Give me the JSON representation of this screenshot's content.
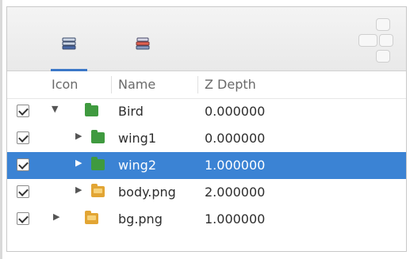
{
  "columns": {
    "icon": "Icon",
    "name": "Name",
    "z_depth": "Z Depth"
  },
  "layers": [
    {
      "name": "Bird",
      "z_depth": "0.000000",
      "checked": true,
      "expander": "expanded",
      "icon": "green-folder-icon",
      "level": 1,
      "selected": false
    },
    {
      "name": "wing1",
      "z_depth": "0.000000",
      "checked": true,
      "expander": "collapsed",
      "icon": "green-folder-icon",
      "level": 2,
      "selected": false
    },
    {
      "name": "wing2",
      "z_depth": "1.000000",
      "checked": true,
      "expander": "collapsed",
      "icon": "green-folder-icon",
      "level": 2,
      "selected": true
    },
    {
      "name": "body.png",
      "z_depth": "2.000000",
      "checked": true,
      "expander": "collapsed",
      "icon": "yellow-image-folder-icon",
      "level": 2,
      "selected": false
    },
    {
      "name": "bg.png",
      "z_depth": "1.000000",
      "checked": true,
      "expander": "collapsed",
      "icon": "yellow-image-folder-icon",
      "level": 1,
      "selected": false
    }
  ],
  "colors": {
    "selection": "#3b83d4",
    "tab_underline": "#3c78c8",
    "folder_green": "#3f9a3f",
    "folder_yellow": "#e2a534"
  }
}
